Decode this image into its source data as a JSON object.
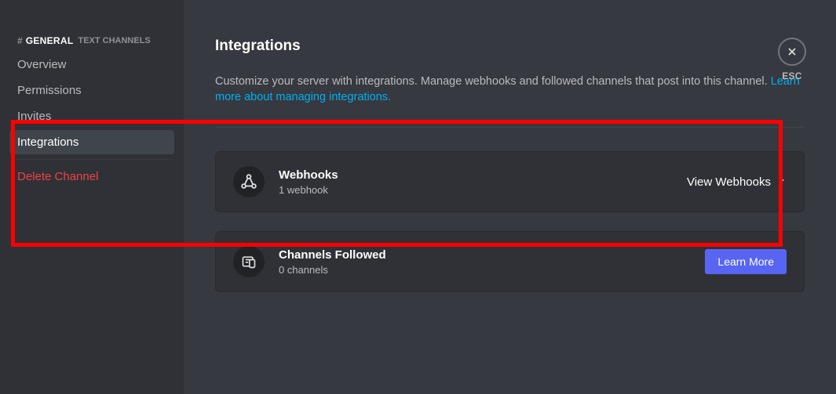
{
  "channel": {
    "hash": "#",
    "name": "GENERAL",
    "category": "TEXT CHANNELS"
  },
  "sidebar": {
    "items": [
      {
        "label": "Overview"
      },
      {
        "label": "Permissions"
      },
      {
        "label": "Invites"
      },
      {
        "label": "Integrations"
      }
    ],
    "delete_label": "Delete Channel"
  },
  "page": {
    "title": "Integrations",
    "description": "Customize your server with integrations. Manage webhooks and followed channels that post into this channel. ",
    "learn_link": "Learn more about managing integrations."
  },
  "webhooks_card": {
    "title": "Webhooks",
    "subtitle": "1 webhook",
    "action": "View Webhooks"
  },
  "followed_card": {
    "title": "Channels Followed",
    "subtitle": "0 channels",
    "action": "Learn More"
  },
  "close": {
    "label": "ESC"
  }
}
